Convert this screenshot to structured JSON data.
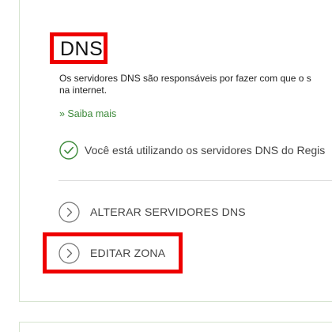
{
  "dns_section": {
    "title": "DNS",
    "description_line1": "Os servidores DNS são responsáveis por fazer com que o s",
    "description_line2": "na internet.",
    "learn_more_link": "» Saiba mais",
    "status_message": "Você está utilizando os servidores DNS do Regis",
    "actions": [
      {
        "label": "ALTERAR SERVIDORES DNS",
        "icon": "chevron-right-circle-icon"
      },
      {
        "label": "EDITAR ZONA",
        "icon": "chevron-right-circle-icon"
      }
    ],
    "status_icon": "check-circle-icon"
  },
  "colors": {
    "accent_green": "#3d8a3a",
    "highlight_red": "#ee0000",
    "card_border": "#d6e4d0"
  }
}
